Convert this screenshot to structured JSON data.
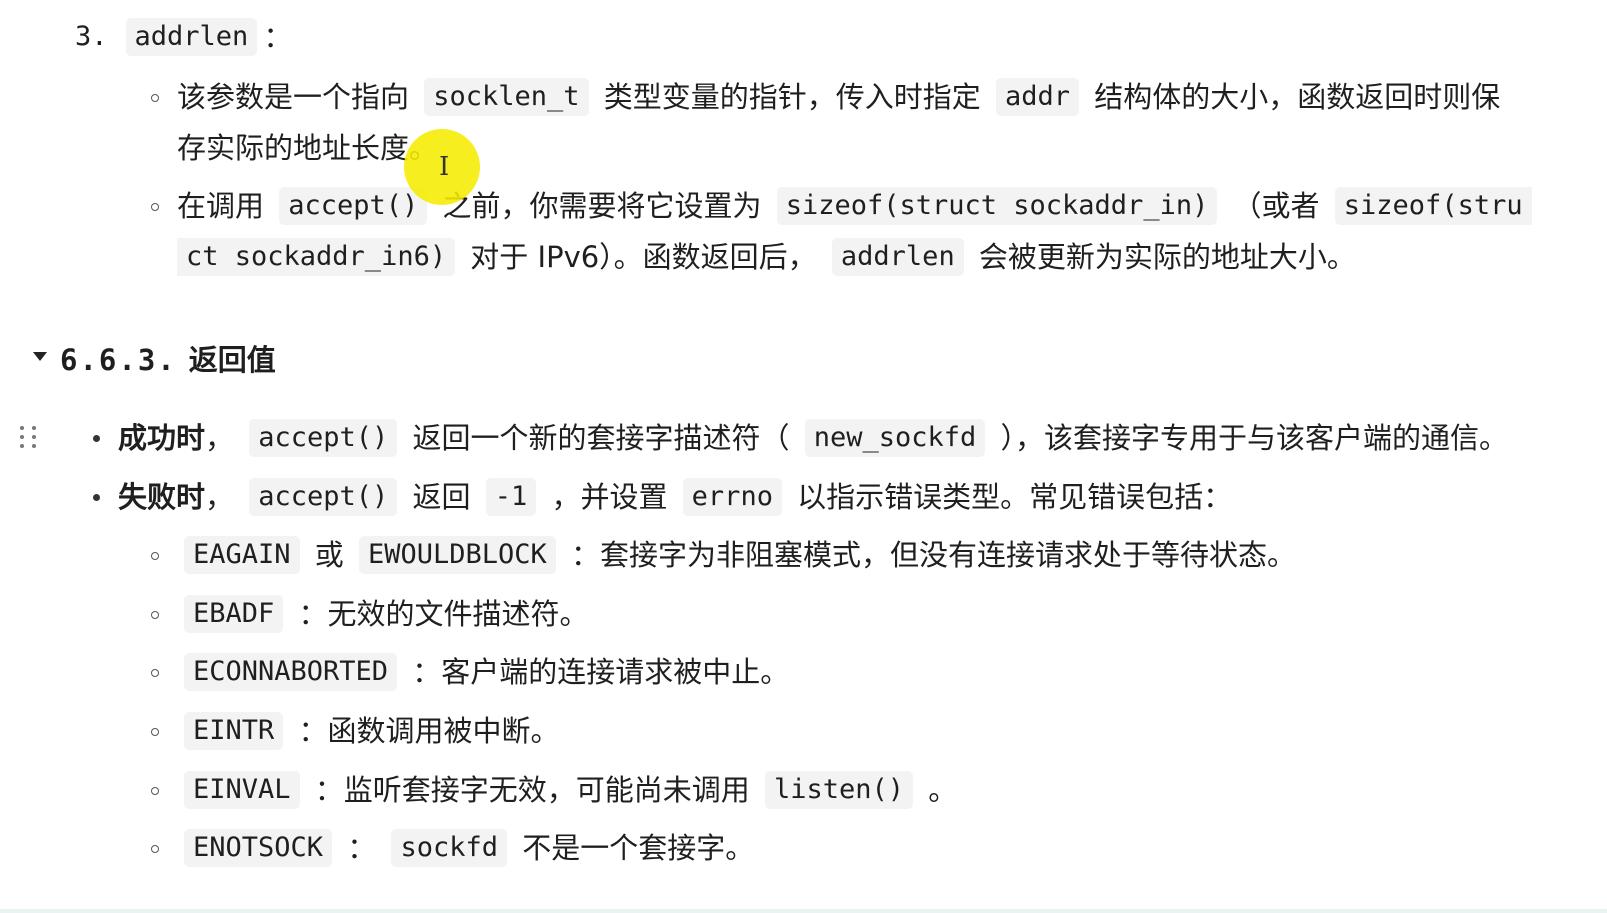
{
  "item3": {
    "number": "3.",
    "code": "addrlen",
    "colon": "：",
    "bullets": [
      {
        "line1": [
          {
            "t": "该参数是一个指向 "
          },
          {
            "c": "socklen_t"
          },
          {
            "t": " 类型变量的指针，传入时指定 "
          },
          {
            "c": "addr"
          },
          {
            "t": " 结构体的大小，函数返回时则保"
          }
        ],
        "line2": [
          {
            "t": "存实际的地址长度。"
          }
        ]
      },
      {
        "line1": [
          {
            "t": "在调用 "
          },
          {
            "c": "accept()"
          },
          {
            "t": " 之前，你需要将它设置为 "
          },
          {
            "c": "sizeof(struct sockaddr_in)"
          },
          {
            "t": " （或者 "
          },
          {
            "c": "sizeof(stru"
          }
        ],
        "line2": [
          {
            "c": "ct sockaddr_in6)"
          },
          {
            "t": " 对于 IPv6）。函数返回后， "
          },
          {
            "c": "addrlen"
          },
          {
            "t": " 会被更新为实际的地址大小。"
          }
        ]
      }
    ]
  },
  "section": {
    "number": "6.6.3.",
    "title": "返回值"
  },
  "success": [
    {
      "b": "成功时"
    },
    {
      "t": "， "
    },
    {
      "c": "accept()"
    },
    {
      "t": " 返回一个新的套接字描述符（ "
    },
    {
      "c": "new_sockfd"
    },
    {
      "t": " ），该套接字专用于与该客户端的通信。"
    }
  ],
  "failure": [
    {
      "b": "失败时"
    },
    {
      "t": "， "
    },
    {
      "c": "accept()"
    },
    {
      "t": " 返回 "
    },
    {
      "c": "-1"
    },
    {
      "t": " ，并设置 "
    },
    {
      "c": "errno"
    },
    {
      "t": " 以指示错误类型。常见错误包括："
    }
  ],
  "errors": [
    [
      {
        "c": "EAGAIN"
      },
      {
        "t": " 或 "
      },
      {
        "c": "EWOULDBLOCK"
      },
      {
        "t": " ：套接字为非阻塞模式，但没有连接请求处于等待状态。"
      }
    ],
    [
      {
        "c": "EBADF"
      },
      {
        "t": " ：无效的文件描述符。"
      }
    ],
    [
      {
        "c": "ECONNABORTED"
      },
      {
        "t": " ：客户端的连接请求被中止。"
      }
    ],
    [
      {
        "c": "EINTR"
      },
      {
        "t": " ：函数调用被中断。"
      }
    ],
    [
      {
        "c": "EINVAL"
      },
      {
        "t": " ：监听套接字无效，可能尚未调用 "
      },
      {
        "c": "listen()"
      },
      {
        "t": " 。"
      }
    ],
    [
      {
        "c": "ENOTSOCK"
      },
      {
        "t": " ： "
      },
      {
        "c": "sockfd"
      },
      {
        "t": " 不是一个套接字。"
      }
    ]
  ],
  "icons": {
    "collapse": "caret-down-icon",
    "drag": "drag-handle-icon",
    "cursor": "text-cursor-icon"
  },
  "colors": {
    "code_bg": "#f3f3f3",
    "cursor_highlight": "#f6ec00"
  }
}
